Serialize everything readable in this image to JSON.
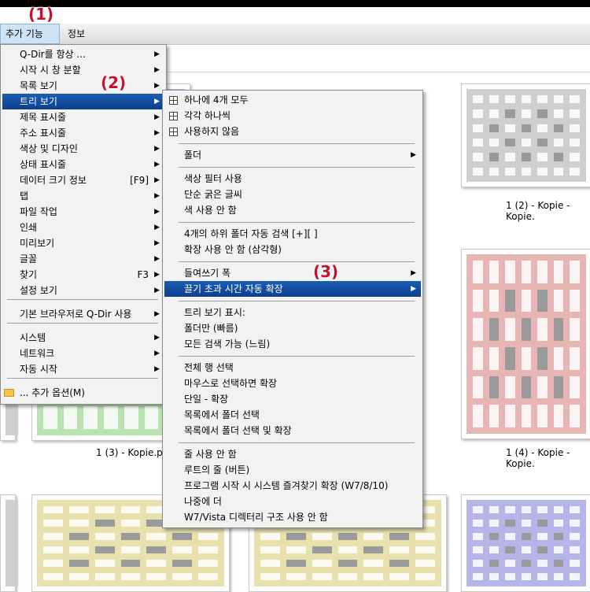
{
  "menubar": {
    "extras": "추가 기능(X)",
    "info": "정보"
  },
  "annotations": {
    "a1": "(1)",
    "a2": "(2)",
    "a3": "(3)"
  },
  "thumbnails": {
    "captions": [
      "1 (2) - Kopie - Kopie.",
      "1 (3) - Kopie.png",
      "1 (4) - Kopie - Kopie."
    ],
    "colors": {
      "gray": "#cfcfcf",
      "purple": "#b5b5e8",
      "pink": "#e8b5b5",
      "green": "#b9e4b2",
      "yellow": "#e8e1ad"
    }
  },
  "main_menu": {
    "items": [
      {
        "label": "Q-Dir를 항상 ...",
        "arrow": "▶"
      },
      {
        "label": "시작 시 창 분할",
        "arrow": "▶"
      },
      {
        "label": "목록 보기",
        "arrow": "▶"
      },
      {
        "label": "트리 보기",
        "arrow": "▶"
      },
      {
        "label": "제목 표시줄",
        "arrow": "▶"
      },
      {
        "label": "주소 표시줄",
        "arrow": "▶"
      },
      {
        "label": "색상 및 디자인",
        "arrow": "▶"
      },
      {
        "label": "상태 표시줄",
        "arrow": "▶"
      },
      {
        "label": "데이터 크기 정보",
        "shortcut": "[F9]",
        "arrow": "▶"
      },
      {
        "label": "탭",
        "arrow": "▶"
      },
      {
        "label": "파일 작업",
        "arrow": "▶"
      },
      {
        "label": "인쇄",
        "arrow": "▶"
      },
      {
        "label": "미리보기",
        "arrow": "▶"
      },
      {
        "label": "글꼴",
        "arrow": "▶"
      },
      {
        "label": "찾기",
        "shortcut": "F3",
        "arrow": "▶"
      },
      {
        "label": "설정 보기",
        "arrow": "▶"
      },
      {
        "label": "기본 브라우저로 Q-Dir 사용",
        "arrow": "▶"
      },
      {
        "label": "시스템",
        "arrow": "▶"
      },
      {
        "label": "네트워크",
        "arrow": "▶"
      },
      {
        "label": "자동 시작",
        "arrow": "▶"
      },
      {
        "label": "... 추가 옵션(M)",
        "icon": "folder-icon"
      }
    ]
  },
  "sub_menu": {
    "items": [
      {
        "label": "하나에 4개 모두",
        "icon": "grid-icon"
      },
      {
        "label": "각각 하나씩",
        "icon": "grid-icon"
      },
      {
        "label": "사용하지 않음",
        "icon": "grid-icon"
      },
      {
        "label": "폴더",
        "arrow": "▶"
      },
      {
        "label": "색상 필터 사용"
      },
      {
        "label": "단순 굵은 글씨"
      },
      {
        "label": "색 사용 안 함"
      },
      {
        "label": "4개의 하위 폴더 자동 검색 [+][ ]"
      },
      {
        "label": "확장 사용 안 함 (삼각형)"
      },
      {
        "label": "들여쓰기 폭",
        "arrow": "▶"
      },
      {
        "label": "끌기 초과 시간 자동 확장",
        "arrow": "▶"
      },
      {
        "label": "트리 보기 표시:"
      },
      {
        "label": "폴더만 (빠름)"
      },
      {
        "label": "모든 검색 가능 (느림)"
      },
      {
        "label": "전체 행 선택"
      },
      {
        "label": "마우스로 선택하면 확장"
      },
      {
        "label": "단일 - 확장"
      },
      {
        "label": "목록에서 폴더 선택"
      },
      {
        "label": "목록에서 폴더 선택 및 확장"
      },
      {
        "label": "줄 사용 안 함"
      },
      {
        "label": "루트의 줄 (버튼)"
      },
      {
        "label": "프로그램 시작 시 시스템 즐겨찾기 확장 (W7/8/10)"
      },
      {
        "label": "나중에 더"
      },
      {
        "label": "W7/Vista 디렉터리 구조 사용 안 함"
      }
    ]
  }
}
